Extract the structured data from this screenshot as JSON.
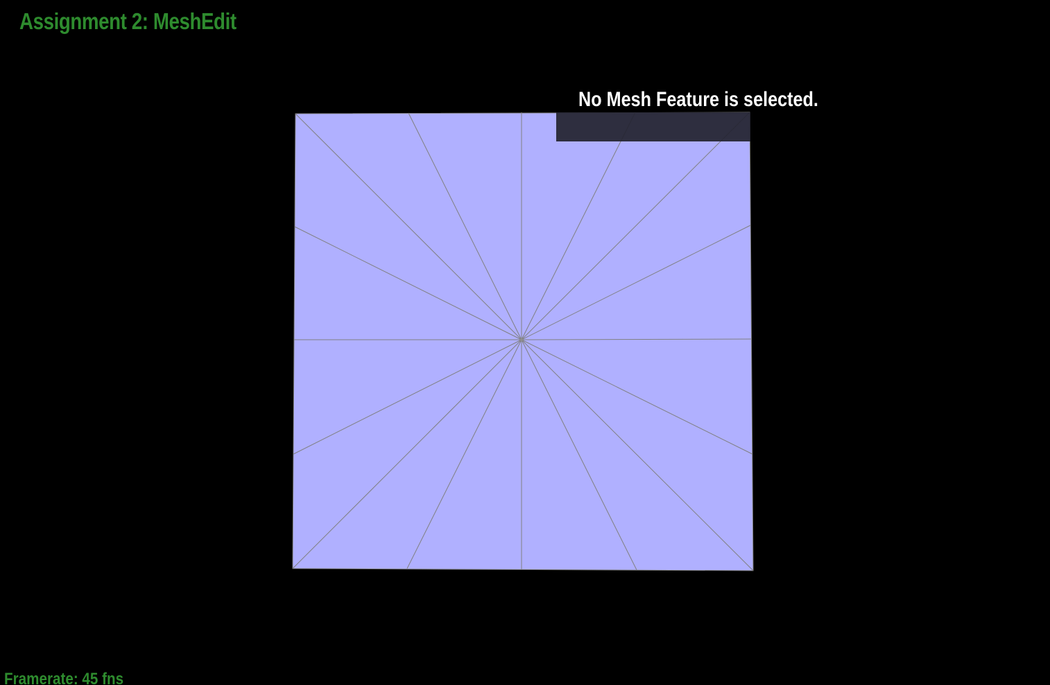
{
  "app": {
    "title": "Assignment 2: MeshEdit",
    "title_color": "#2e8b2e"
  },
  "status": {
    "framerate_text": "Framerate: 45 fns",
    "color": "#2e8b2e"
  },
  "selection": {
    "message": "No Mesh Feature is selected."
  },
  "mesh": {
    "face_color": "#b0b0ff",
    "edge_color": "#808080"
  }
}
